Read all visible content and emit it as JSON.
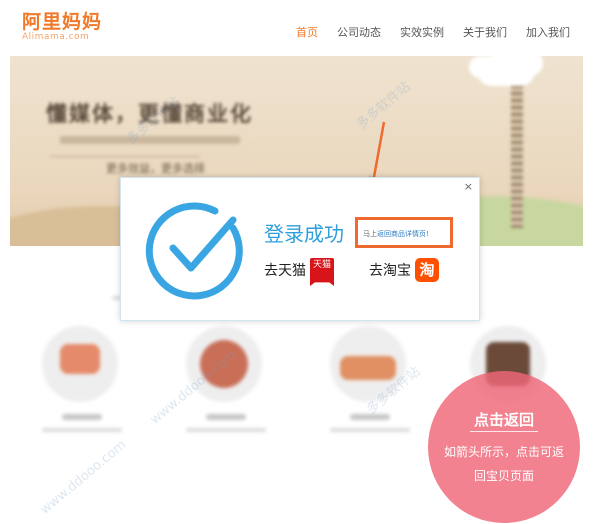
{
  "header": {
    "logo_cn": "阿里妈妈",
    "logo_en": "Alimama.com",
    "nav": [
      {
        "label": "首页",
        "active": true
      },
      {
        "label": "公司动态",
        "active": false
      },
      {
        "label": "实效实例",
        "active": false
      },
      {
        "label": "关于我们",
        "active": false
      },
      {
        "label": "加入我们",
        "active": false
      }
    ]
  },
  "banner": {
    "title": "懂媒体，更懂商业化",
    "slogan": "更多效益，更多选择"
  },
  "dialog": {
    "close_label": "×",
    "title": "登录成功",
    "link_prefix": "马上",
    "link_text": "返回商品详情页!",
    "go_tmall_label": "去天猫",
    "tmall_badge": "天猫",
    "go_taobao_label": "去淘宝",
    "taobao_badge": "淘"
  },
  "annotation": {
    "title": "点击返回",
    "line1": "如箭头所示，点击可返",
    "line2": "回宝贝页面"
  },
  "watermark": {
    "text1": "多多软件站",
    "text2": "www.ddooo.com"
  },
  "colors": {
    "accent_orange": "#f07a2c",
    "success_blue": "#2e9fdc",
    "highlight_box": "#ef6a2e",
    "annotation_pink": "#ef6778",
    "tmall_red": "#d8141b",
    "taobao_orange": "#ff5000"
  },
  "icons": {
    "check": "check-circle-icon",
    "close": "close-icon",
    "arrow": "arrow-down-left-icon"
  }
}
